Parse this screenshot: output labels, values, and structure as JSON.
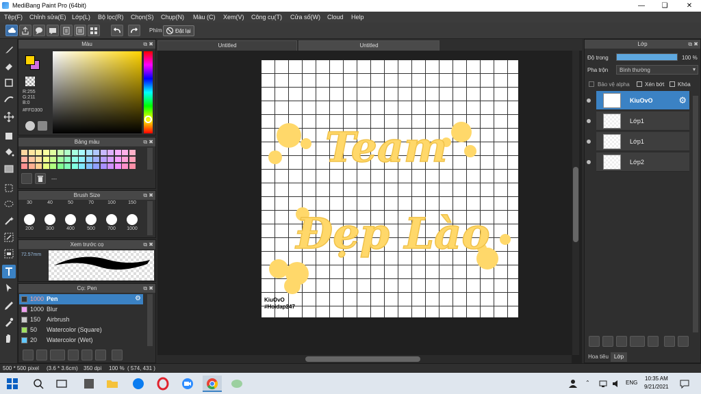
{
  "window": {
    "title": "MediBang Paint Pro (64bit)"
  },
  "menu": [
    "Tệp(F)",
    "Chỉnh sửa(E)",
    "Lớp(L)",
    "Bộ lọc(R)",
    "Chọn(S)",
    "Chụp(N)",
    "Màu (C)",
    "Xem(V)",
    "Công cụ(T)",
    "Cửa số(W)",
    "Cloud",
    "Help"
  ],
  "toolbar": {
    "keys_label": "Phím",
    "reset_label": "Đặt lại"
  },
  "color_panel": {
    "title": "Màu",
    "r": "R:255",
    "g": "G:211",
    "b": "B:0",
    "hex": "#FFD300",
    "colors": {
      "primary": "#ffd300",
      "secondary": "#d070e0"
    }
  },
  "palette_panel": {
    "title": "Bảng màu",
    "status": "---",
    "rows": [
      [
        "#ffd6a0",
        "#ffe6a0",
        "#fff0a0",
        "#f8ffa0",
        "#e0ffa0",
        "#c8ffb0",
        "#b0ffc8",
        "#a8ffe0",
        "#a8f8ff",
        "#a8e0ff",
        "#b0c8ff",
        "#c8b8ff",
        "#e0b0ff",
        "#f8b0ff",
        "#ffb0e8",
        "#ffb0c8"
      ],
      [
        "#ffb0a0",
        "#ffc8a0",
        "#ffe0a0",
        "#f0ff90",
        "#c8ff90",
        "#a0ffa0",
        "#90ffc0",
        "#90ffe8",
        "#90f0ff",
        "#90d0ff",
        "#a0b0ff",
        "#b8a0ff",
        "#d8a0ff",
        "#f8a0ff",
        "#ffa0d8",
        "#ffa0b8"
      ],
      [
        "#ff9090",
        "#ffb090",
        "#ffd090",
        "#e8ff80",
        "#b0ff80",
        "#80ff90",
        "#80ffb8",
        "#80ffe0",
        "#80e8ff",
        "#80c0ff",
        "#90a0ff",
        "#a890ff",
        "#d090ff",
        "#f090ff",
        "#ff90c8",
        "#ff90a8"
      ]
    ]
  },
  "brush_size_panel": {
    "title": "Brush Size",
    "top_row": [
      "30",
      "40",
      "50",
      "70",
      "100",
      "150"
    ],
    "bottom_row": [
      "200",
      "300",
      "400",
      "500",
      "700",
      "1000"
    ]
  },
  "preview_panel": {
    "title": "Xem trước cọ",
    "size": "72.57mm"
  },
  "brush_panel": {
    "title": "Cọ: Pen",
    "brushes": [
      {
        "size": "1000",
        "name": "Pen",
        "color": "#333333",
        "active": true
      },
      {
        "size": "1000",
        "name": "Blur",
        "color": "#f0a0f0",
        "active": false
      },
      {
        "size": "150",
        "name": "Airbrush",
        "color": "#cccccc",
        "active": false
      },
      {
        "size": "50",
        "name": "Watercolor (Square)",
        "color": "#a0e060",
        "active": false
      },
      {
        "size": "20",
        "name": "Watercolor (Wet)",
        "color": "#60c8ff",
        "active": false
      }
    ]
  },
  "canvas": {
    "tabs": [
      "Untitled",
      "Untitled"
    ],
    "artwork": {
      "line1": "Team",
      "line2": "Đẹp Lào",
      "signature_name": "KiuOvO",
      "signature_tag": "#Hoidap247",
      "ink_color": "#ffd86a",
      "ink_highlight": "#ffe89a"
    }
  },
  "status_bar": {
    "size": "500 * 500 pixel",
    "physical": "(3.6 * 3.6cm)",
    "dpi": "350 dpi",
    "zoom": "100 %",
    "coords": "( 574, 431 )"
  },
  "layers_panel": {
    "title": "Lớp",
    "opacity_label": "Độ trong",
    "opacity_value": "100 %",
    "opacity_fraction": 1.0,
    "blend_label": "Pha trộn",
    "blend_value": "Bình thường",
    "protect_alpha": "Bảo vệ alpha",
    "clipping": "Xén bớt",
    "lock": "Khóa",
    "layers": [
      {
        "name": "KiuOvO",
        "active": true
      },
      {
        "name": "Lớp1",
        "active": false
      },
      {
        "name": "Lớp1",
        "active": false
      },
      {
        "name": "Lớp2",
        "active": false
      }
    ],
    "bottom_tabs": [
      "Hoa tiêu",
      "Lớp"
    ]
  },
  "taskbar": {
    "time": "10:35 AM",
    "date": "9/21/2021",
    "language": "ENG"
  }
}
